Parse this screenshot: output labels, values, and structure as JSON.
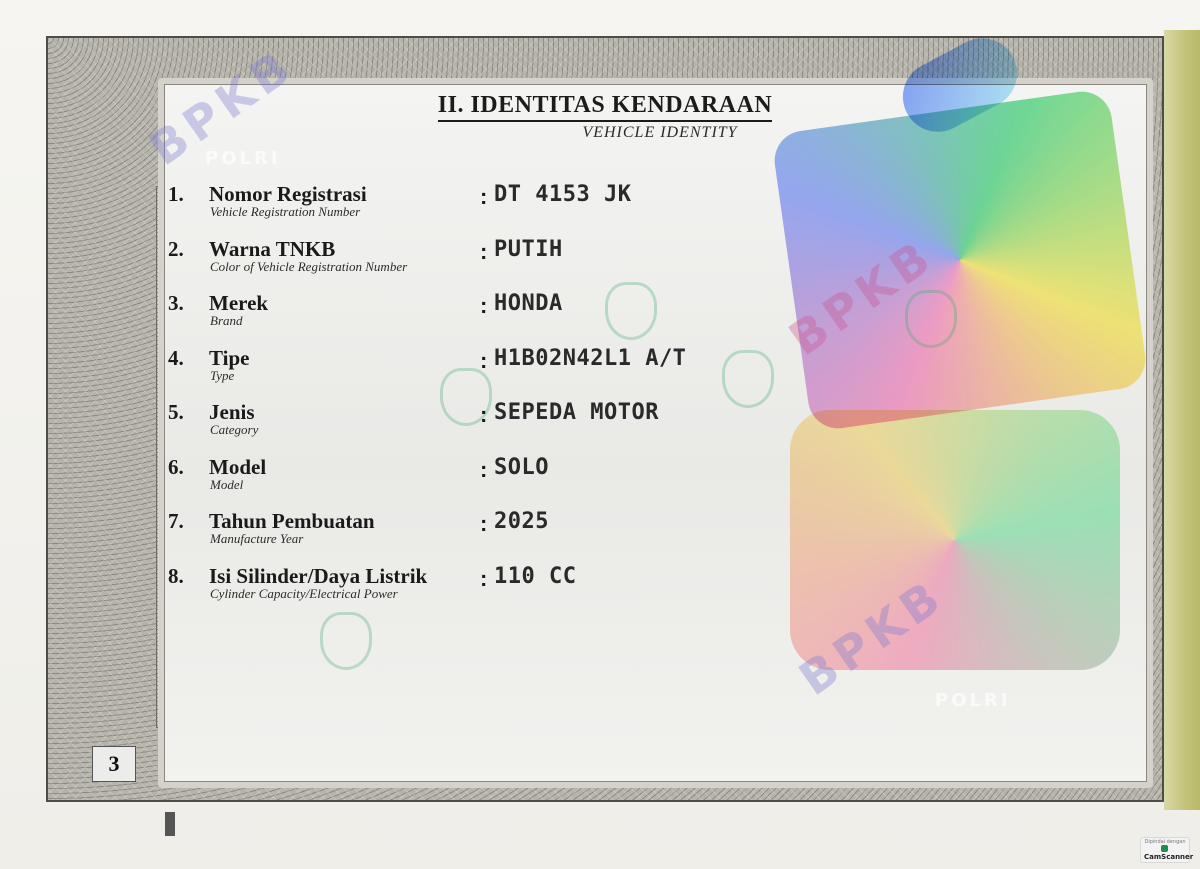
{
  "document": {
    "heading_title": "II. IDENTITAS KENDARAAN",
    "heading_subtitle": "VEHICLE IDENTITY",
    "page_number": "3",
    "watermark_text": "BPKB",
    "watermark_secondary": "POLRI",
    "fields": [
      {
        "number": "1.",
        "label": "Nomor Registrasi",
        "sublabel": "Vehicle Registration Number",
        "value": "DT 4153 JK"
      },
      {
        "number": "2.",
        "label": "Warna TNKB",
        "sublabel": "Color of Vehicle Registration Number",
        "value": "PUTIH"
      },
      {
        "number": "3.",
        "label": "Merek",
        "sublabel": "Brand",
        "value": "HONDA"
      },
      {
        "number": "4.",
        "label": "Tipe",
        "sublabel": "Type",
        "value": "H1B02N42L1 A/T"
      },
      {
        "number": "5.",
        "label": "Jenis",
        "sublabel": "Category",
        "value": "SEPEDA MOTOR"
      },
      {
        "number": "6.",
        "label": "Model",
        "sublabel": "Model",
        "value": "SOLO"
      },
      {
        "number": "7.",
        "label": "Tahun Pembuatan",
        "sublabel": "Manufacture Year",
        "value": "2025"
      },
      {
        "number": "8.",
        "label": "Isi Silinder/Daya Listrik",
        "sublabel": "Cylinder Capacity/Electrical Power",
        "value": "110 CC"
      }
    ],
    "colon": ":"
  },
  "scanner_badge": {
    "top_text": "Dipindai dengan",
    "brand": "CamScanner"
  },
  "colors": {
    "frame": "#a6a39b",
    "panel": "#ededea",
    "text": "#1a1a1a",
    "spine": "#c3c37a"
  }
}
